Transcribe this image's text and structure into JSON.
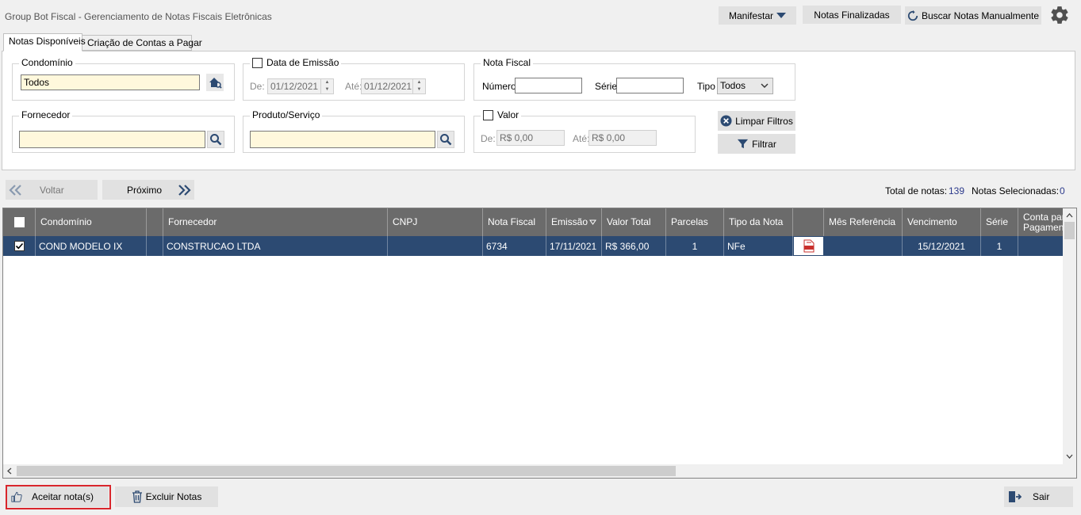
{
  "window": {
    "title": "Group Bot Fiscal - Gerenciamento de Notas Fiscais Eletrônicas"
  },
  "toolbar": {
    "manifestar": "Manifestar",
    "finalizadas": "Notas Finalizadas",
    "buscar": "Buscar Notas Manualmente"
  },
  "tabs": [
    {
      "label": "Notas Disponíveis",
      "active": true
    },
    {
      "label": "Criação de Contas a Pagar",
      "active": false
    }
  ],
  "filters": {
    "condominio": {
      "label": "Condomínio",
      "value": "Todos"
    },
    "data_emissao": {
      "label": "Data de Emissão",
      "checked": false,
      "de_label": "De:",
      "de": "01/12/2021",
      "ate_label": "Até:",
      "ate": "01/12/2021"
    },
    "nota_fiscal": {
      "label": "Nota Fiscal",
      "numero_label": "Número",
      "numero": "",
      "serie_label": "Série",
      "serie": "",
      "tipo_label": "Tipo",
      "tipo": "Todos"
    },
    "fornecedor": {
      "label": "Fornecedor",
      "value": ""
    },
    "produto": {
      "label": "Produto/Serviço",
      "value": ""
    },
    "valor": {
      "label": "Valor",
      "checked": false,
      "de_label": "De:",
      "de": "R$ 0,00",
      "ate_label": "Até:",
      "ate": "R$ 0,00"
    },
    "limpar": "Limpar Filtros",
    "filtrar": "Filtrar"
  },
  "pager": {
    "voltar": "Voltar",
    "proximo": "Próximo",
    "total_label": "Total de notas:",
    "total": "139",
    "selecionadas_label": "Notas Selecionadas:",
    "selecionadas": "0"
  },
  "table": {
    "columns": [
      "Condomínio",
      "",
      "Fornecedor",
      "CNPJ",
      "Nota Fiscal",
      "Emissão",
      "Valor Total",
      "Parcelas",
      "Tipo da Nota",
      "",
      "Mês Referência",
      "Vencimento",
      "Série",
      "Conta para Pagamento"
    ],
    "rows": [
      {
        "checked": true,
        "condominio": "COND MODELO IX",
        "fornecedor": "CONSTRUCAO LTDA",
        "cnpj": "",
        "nota": "6734",
        "emissao": "17/11/2021",
        "valor": "R$ 366,00",
        "parcelas": "1",
        "tipo": "NFe",
        "pdf_icon": "pdf-icon",
        "mes": "",
        "vencimento": "15/12/2021",
        "serie": "1",
        "conta": ""
      }
    ]
  },
  "footer": {
    "aceitar": "Aceitar nota(s)",
    "excluir": "Excluir Notas",
    "sair": "Sair"
  }
}
